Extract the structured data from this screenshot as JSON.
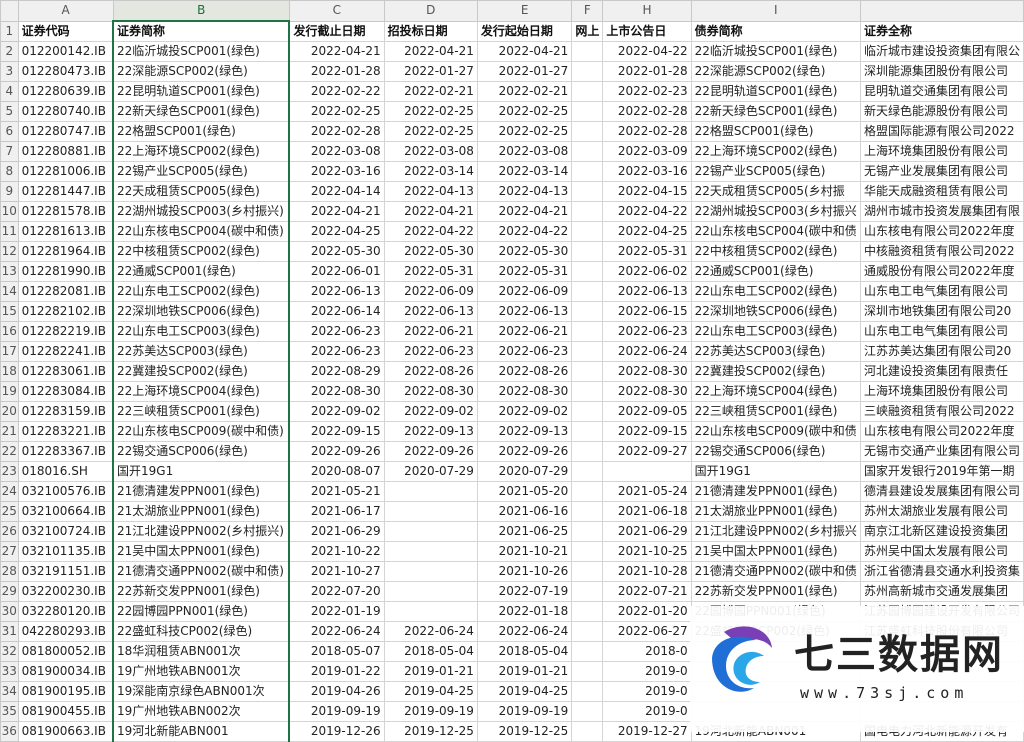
{
  "columns": [
    "A",
    "B",
    "C",
    "D",
    "E",
    "F",
    "H",
    "I",
    ""
  ],
  "rows": [
    [
      "证券代码",
      "证券简称",
      "发行截止日期",
      "招投标日期",
      "发行起始日期",
      "网上",
      "上市公告日",
      "债券简称",
      "证券全称"
    ],
    [
      "012200142.IB",
      "22临沂城投SCP001(绿色)",
      "2022-04-21",
      "2022-04-21",
      "2022-04-21",
      "",
      "2022-04-22",
      "22临沂城投SCP001(绿色)",
      "临沂城市建设投资集团有限公"
    ],
    [
      "012280473.IB",
      "22深能源SCP002(绿色)",
      "2022-01-28",
      "2022-01-27",
      "2022-01-27",
      "",
      "2022-01-28",
      "22深能源SCP002(绿色)",
      "深圳能源集团股份有限公司"
    ],
    [
      "012280639.IB",
      "22昆明轨道SCP001(绿色)",
      "2022-02-22",
      "2022-02-21",
      "2022-02-21",
      "",
      "2022-02-23",
      "22昆明轨道SCP001(绿色)",
      "昆明轨道交通集团有限公司"
    ],
    [
      "012280740.IB",
      "22新天绿色SCP001(绿色)",
      "2022-02-25",
      "2022-02-25",
      "2022-02-25",
      "",
      "2022-02-28",
      "22新天绿色SCP001(绿色)",
      "新天绿色能源股份有限公司"
    ],
    [
      "012280747.IB",
      "22格盟SCP001(绿色)",
      "2022-02-28",
      "2022-02-25",
      "2022-02-25",
      "",
      "2022-02-28",
      "22格盟SCP001(绿色)",
      "格盟国际能源有限公司2022"
    ],
    [
      "012280881.IB",
      "22上海环境SCP002(绿色)",
      "2022-03-08",
      "2022-03-08",
      "2022-03-08",
      "",
      "2022-03-09",
      "22上海环境SCP002(绿色)",
      "上海环境集团股份有限公司"
    ],
    [
      "012281006.IB",
      "22锡产业SCP005(绿色)",
      "2022-03-16",
      "2022-03-14",
      "2022-03-14",
      "",
      "2022-03-16",
      "22锡产业SCP005(绿色)",
      "无锡产业发展集团有限公司"
    ],
    [
      "012281447.IB",
      "22天成租赁SCP005(绿色)",
      "2022-04-14",
      "2022-04-13",
      "2022-04-13",
      "",
      "2022-04-15",
      "22天成租赁SCP005(乡村振",
      "华能天成融资租赁有限公司"
    ],
    [
      "012281578.IB",
      "22湖州城投SCP003(乡村振兴)",
      "2022-04-21",
      "2022-04-21",
      "2022-04-21",
      "",
      "2022-04-22",
      "22湖州城投SCP003(乡村振兴",
      "湖州市城市投资发展集团有限"
    ],
    [
      "012281613.IB",
      "22山东核电SCP004(碳中和债)",
      "2022-04-25",
      "2022-04-22",
      "2022-04-22",
      "",
      "2022-04-25",
      "22山东核电SCP004(碳中和债",
      "山东核电有限公司2022年度"
    ],
    [
      "012281964.IB",
      "22中核租赁SCP002(绿色)",
      "2022-05-30",
      "2022-05-30",
      "2022-05-30",
      "",
      "2022-05-31",
      "22中核租赁SCP002(绿色)",
      "中核融资租赁有限公司2022"
    ],
    [
      "012281990.IB",
      "22通威SCP001(绿色)",
      "2022-06-01",
      "2022-05-31",
      "2022-05-31",
      "",
      "2022-06-02",
      "22通威SCP001(绿色)",
      "通威股份有限公司2022年度"
    ],
    [
      "012282081.IB",
      "22山东电工SCP002(绿色)",
      "2022-06-13",
      "2022-06-09",
      "2022-06-09",
      "",
      "2022-06-13",
      "22山东电工SCP002(绿色)",
      "山东电工电气集团有限公司"
    ],
    [
      "012282102.IB",
      "22深圳地铁SCP006(绿色)",
      "2022-06-14",
      "2022-06-13",
      "2022-06-13",
      "",
      "2022-06-15",
      "22深圳地铁SCP006(绿色)",
      "深圳市地铁集团有限公司20"
    ],
    [
      "012282219.IB",
      "22山东电工SCP003(绿色)",
      "2022-06-23",
      "2022-06-21",
      "2022-06-21",
      "",
      "2022-06-23",
      "22山东电工SCP003(绿色)",
      "山东电工电气集团有限公司"
    ],
    [
      "012282241.IB",
      "22苏美达SCP003(绿色)",
      "2022-06-23",
      "2022-06-23",
      "2022-06-23",
      "",
      "2022-06-24",
      "22苏美达SCP003(绿色)",
      "江苏苏美达集团有限公司20"
    ],
    [
      "012283061.IB",
      "22冀建投SCP002(绿色)",
      "2022-08-29",
      "2022-08-26",
      "2022-08-26",
      "",
      "2022-08-30",
      "22冀建投SCP002(绿色)",
      "河北建设投资集团有限责任"
    ],
    [
      "012283084.IB",
      "22上海环境SCP004(绿色)",
      "2022-08-30",
      "2022-08-30",
      "2022-08-30",
      "",
      "2022-08-30",
      "22上海环境SCP004(绿色)",
      "上海环境集团股份有限公司"
    ],
    [
      "012283159.IB",
      "22三峡租赁SCP001(绿色)",
      "2022-09-02",
      "2022-09-02",
      "2022-09-02",
      "",
      "2022-09-05",
      "22三峡租赁SCP001(绿色)",
      "三峡融资租赁有限公司2022"
    ],
    [
      "012283221.IB",
      "22山东核电SCP009(碳中和债)",
      "2022-09-15",
      "2022-09-13",
      "2022-09-13",
      "",
      "2022-09-15",
      "22山东核电SCP009(碳中和债",
      "山东核电有限公司2022年度"
    ],
    [
      "012283367.IB",
      "22锡交通SCP006(绿色)",
      "2022-09-26",
      "2022-09-26",
      "2022-09-26",
      "",
      "2022-09-27",
      "22锡交通SCP006(绿色)",
      "无锡市交通产业集团有限公司"
    ],
    [
      "018016.SH",
      "国开19G1",
      "2020-08-07",
      "2020-07-29",
      "2020-07-29",
      "",
      "",
      "国开19G1",
      "国家开发银行2019年第一期"
    ],
    [
      "032100576.IB",
      "21德清建发PPN001(绿色)",
      "2021-05-21",
      "",
      "2021-05-20",
      "",
      "2021-05-24",
      "21德清建发PPN001(绿色)",
      "德清县建设发展集团有限公司"
    ],
    [
      "032100664.IB",
      "21太湖旅业PPN001(绿色)",
      "2021-06-17",
      "",
      "2021-06-16",
      "",
      "2021-06-18",
      "21太湖旅业PPN001(绿色)",
      "苏州太湖旅业发展有限公司"
    ],
    [
      "032100724.IB",
      "21江北建设PPN002(乡村振兴)",
      "2021-06-29",
      "",
      "2021-06-25",
      "",
      "2021-06-29",
      "21江北建设PPN002(乡村振兴",
      "南京江北新区建设投资集团"
    ],
    [
      "032101135.IB",
      "21吴中国太PPN001(绿色)",
      "2021-10-22",
      "",
      "2021-10-21",
      "",
      "2021-10-25",
      "21吴中国太PPN001(绿色)",
      "苏州吴中国太发展有限公司"
    ],
    [
      "032191151.IB",
      "21德清交通PPN002(碳中和债)",
      "2021-10-27",
      "",
      "2021-10-26",
      "",
      "2021-10-28",
      "21德清交通PPN002(碳中和债",
      "浙江省德清县交通水利投资集"
    ],
    [
      "032200230.IB",
      "22苏新交发PPN001(绿色)",
      "2022-07-20",
      "",
      "2022-07-19",
      "",
      "2022-07-21",
      "22苏新交发PPN001(绿色)",
      "苏州高新城市交通发展集团"
    ],
    [
      "032280120.IB",
      "22园博园PPN001(绿色)",
      "2022-01-19",
      "",
      "2022-01-18",
      "",
      "2022-01-20",
      "22园博园PPN001(绿色)",
      "江苏园博园建设开发有限公司"
    ],
    [
      "042280293.IB",
      "22盛虹科技CP002(绿色)",
      "2022-06-24",
      "2022-06-24",
      "2022-06-24",
      "",
      "2022-06-27",
      "22盛虹科技CP002(绿色)",
      "江苏盛虹科技股份有限公司"
    ],
    [
      "081800052.IB",
      "18华润租赁ABN001次",
      "2018-05-07",
      "2018-05-04",
      "2018-05-04",
      "",
      "2018-0",
      "",
      ""
    ],
    [
      "081900034.IB",
      "19广州地铁ABN001次",
      "2019-01-22",
      "2019-01-21",
      "2019-01-21",
      "",
      "2019-0",
      "",
      ""
    ],
    [
      "081900195.IB",
      "19深能南京绿色ABN001次",
      "2019-04-26",
      "2019-04-25",
      "2019-04-25",
      "",
      "2019-0",
      "",
      ""
    ],
    [
      "081900455.IB",
      "19广州地铁ABN002次",
      "2019-09-19",
      "2019-09-19",
      "2019-09-19",
      "",
      "2019-0",
      "",
      ""
    ],
    [
      "081900663.IB",
      "19河北新能ABN001",
      "2019-12-26",
      "2019-12-25",
      "2019-12-25",
      "",
      "2019-12-27",
      "19河北新能ABN001",
      "国电电力河北新能源开发有"
    ]
  ],
  "watermark": {
    "title": "七三数据网",
    "url": "www.73sj.com"
  },
  "colors": {
    "selected": "#217346",
    "header_bg": "#f0f0f0",
    "grid": "#d4d4d4"
  }
}
